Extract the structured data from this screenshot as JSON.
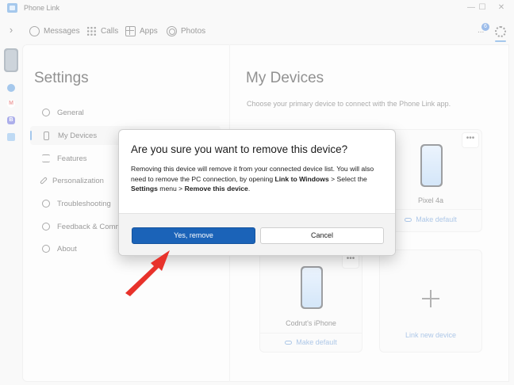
{
  "window": {
    "title": "Phone Link",
    "minimize": "—",
    "maximize": "☐",
    "close": "✕"
  },
  "nav": {
    "expander": "›",
    "tabs": [
      {
        "label": "Messages",
        "icon": "message-icon"
      },
      {
        "label": "Calls",
        "icon": "dialpad-icon"
      },
      {
        "label": "Apps",
        "icon": "apps-icon"
      },
      {
        "label": "Photos",
        "icon": "photos-icon"
      }
    ],
    "notification_count": "6",
    "notification_icon": "..."
  },
  "settings": {
    "title": "Settings",
    "menu": [
      {
        "label": "General",
        "icon": "gear-icon"
      },
      {
        "label": "My Devices",
        "icon": "phone-icon",
        "active": true
      },
      {
        "label": "Features",
        "icon": "list-icon"
      },
      {
        "label": "Personalization",
        "icon": "brush-icon"
      },
      {
        "label": "Troubleshooting",
        "icon": "wrench-icon"
      },
      {
        "label": "Feedback & Comm",
        "icon": "people-icon"
      },
      {
        "label": "About",
        "icon": "info-icon"
      }
    ]
  },
  "devices": {
    "title": "My Devices",
    "subtitle": "Choose your primary device to connect with the Phone Link app.",
    "cards": [
      {
        "name": "Pixel 4a",
        "action": "Make default",
        "more": "•••"
      },
      {
        "name": "Codrut's iPhone",
        "action": "Make default",
        "more": "•••"
      }
    ],
    "link_new": "Link new device"
  },
  "dialog": {
    "title": "Are you sure you want to remove this device?",
    "body_1": "Removing this device will remove it from your connected device list. You will also need to remove the PC connection, by opening ",
    "body_link_windows": "Link to Windows",
    "body_2": " > Select the ",
    "body_settings": "Settings",
    "body_3": " menu > ",
    "body_remove": "Remove this device",
    "body_4": ".",
    "confirm": "Yes, remove",
    "cancel": "Cancel"
  },
  "colors": {
    "accent": "#1b63b8",
    "arrow": "#e8322b",
    "link": "#5b8fd0"
  }
}
